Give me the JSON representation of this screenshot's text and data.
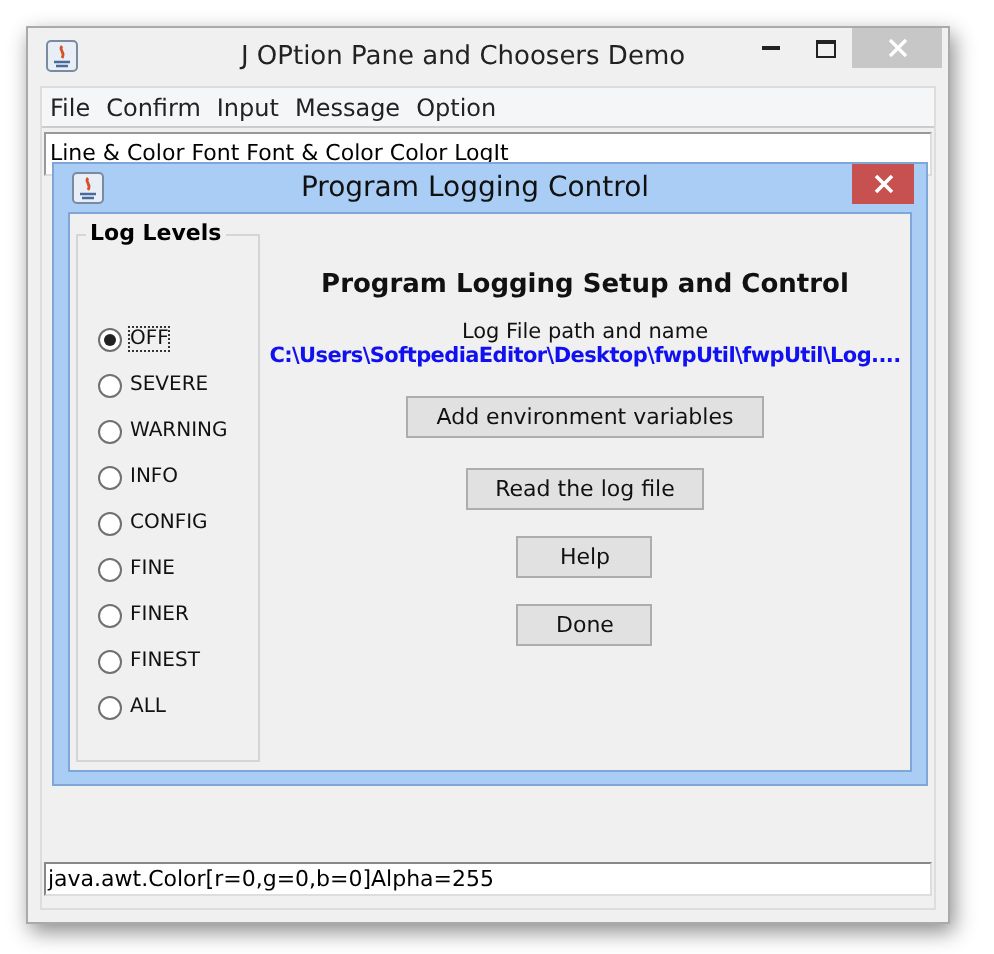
{
  "window": {
    "title": "J OPtion Pane and Choosers   Demo"
  },
  "menu": [
    "File",
    "Confirm",
    "Input",
    "Message",
    "Option"
  ],
  "text_line": "Line & Color  Font  Font & Color  Color  LogIt",
  "dialog": {
    "title": "Program Logging Control",
    "group_title": "Log Levels",
    "levels": [
      {
        "label": "OFF",
        "selected": true
      },
      {
        "label": "SEVERE",
        "selected": false
      },
      {
        "label": "WARNING",
        "selected": false
      },
      {
        "label": "INFO",
        "selected": false
      },
      {
        "label": "CONFIG",
        "selected": false
      },
      {
        "label": "FINE",
        "selected": false
      },
      {
        "label": "FINER",
        "selected": false
      },
      {
        "label": "FINEST",
        "selected": false
      },
      {
        "label": "ALL",
        "selected": false
      }
    ],
    "heading": "Program Logging Setup and Control",
    "path_label": "Log File path and name",
    "path": "C:\\Users\\SoftpediaEditor\\Desktop\\fwpUtil\\fwpUtil\\Log....",
    "buttons": [
      "Add environment variables",
      "Read the log file",
      "Help",
      "Done"
    ]
  },
  "status": "java.awt.Color[r=0,g=0,b=0]Alpha=255"
}
